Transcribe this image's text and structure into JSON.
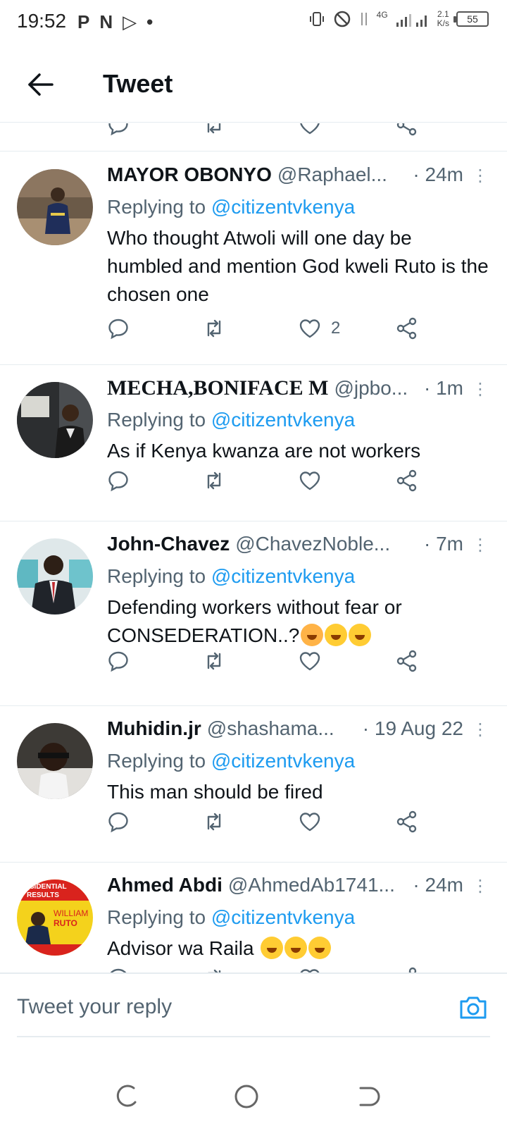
{
  "status_bar": {
    "time": "19:52",
    "left_icons": [
      "P",
      "N",
      "▷",
      "•"
    ],
    "network": "4G",
    "speed_top": "2.1",
    "speed_bottom": "K/s",
    "battery": "55"
  },
  "header": {
    "title": "Tweet"
  },
  "tweets": [
    {
      "name": "MAYOR OBONYO",
      "handle": "@Raphael...",
      "time": "· 24m",
      "replying_prefix": "Replying to",
      "replying_to": "@citizentvkenya",
      "text": "Who thought Atwoli will one day be humbled and mention God kweli Ruto is the chosen one",
      "like_count": "2"
    },
    {
      "name": "MECHA,BONIFACE M",
      "handle": "@jpbo...",
      "time": "· 1m",
      "replying_prefix": "Replying to",
      "replying_to": "@citizentvkenya",
      "text": "As if Kenya kwanza are not workers",
      "like_count": ""
    },
    {
      "name": "John-Chavez",
      "handle": "@ChavezNoble...",
      "time": "· 7m",
      "replying_prefix": "Replying to",
      "replying_to": "@citizentvkenya",
      "text": "Defending workers without fear or CONSEDERATION..?",
      "like_count": ""
    },
    {
      "name": "Muhidin.jr",
      "handle": "@shashama...",
      "time": "· 19 Aug 22",
      "replying_prefix": "Replying to",
      "replying_to": "@citizentvkenya",
      "text": "This man should be fired",
      "like_count": ""
    },
    {
      "name": "Ahmed Abdi",
      "handle": "@AhmedAb1741...",
      "time": "· 24m",
      "replying_prefix": "Replying to",
      "replying_to": "@citizentvkenya",
      "text": "Advisor wa Raila",
      "like_count": "",
      "avatar_text": [
        "RESIDENTIAL",
        "RESULTS",
        "WILLIAM",
        "RUTO"
      ]
    }
  ],
  "reply_bar": {
    "placeholder": "Tweet your reply"
  },
  "colors": {
    "accent": "#1d9bf0",
    "text": "#0f1419",
    "muted": "#536471",
    "divider": "#e6ecf0"
  },
  "icons": {
    "back": "arrow-left-icon",
    "reply": "speech-bubble-icon",
    "retweet": "retweet-icon",
    "like": "heart-icon",
    "share": "share-icon",
    "camera": "camera-icon"
  }
}
